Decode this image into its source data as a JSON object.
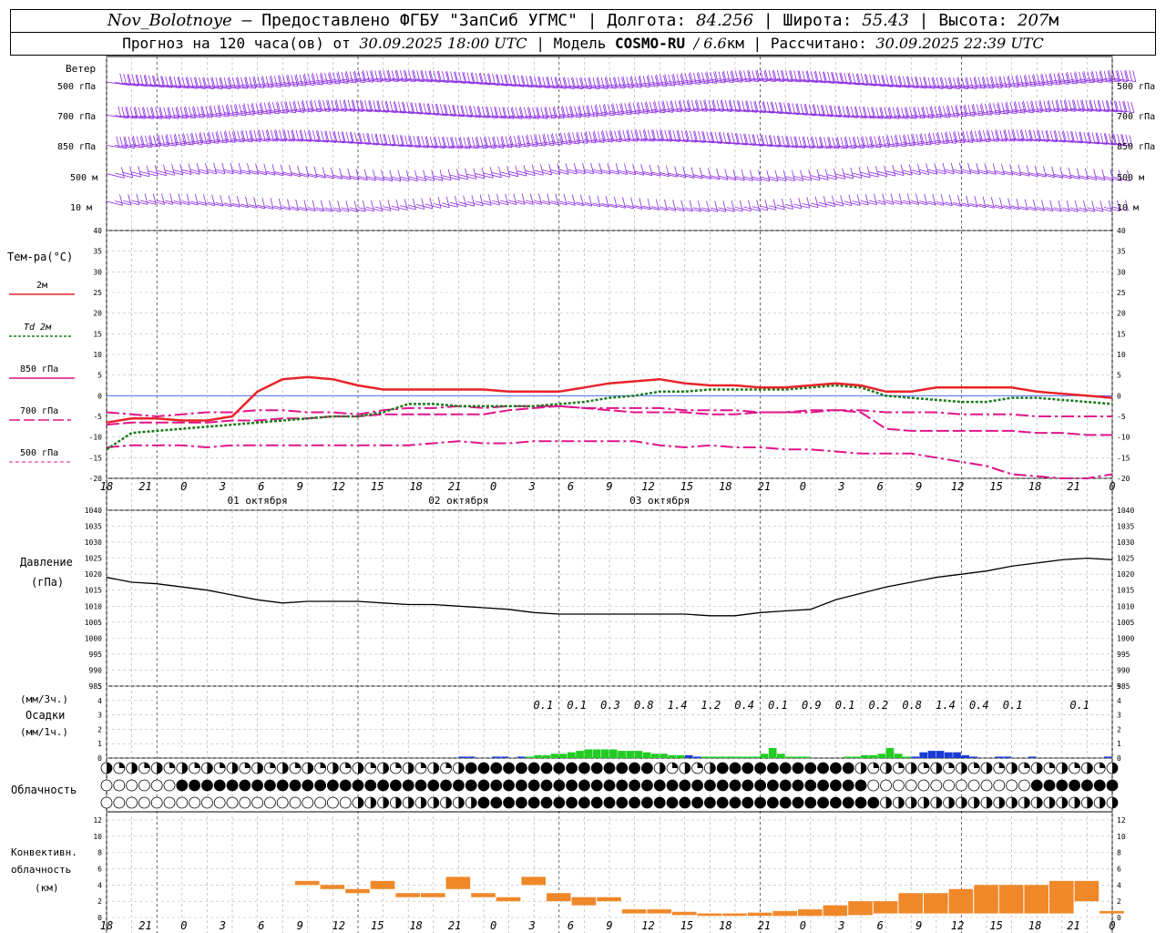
{
  "header": {
    "station": "Nov_Bolotnoye",
    "provider": "– Предоставлено ФГБУ \"ЗапСиб УГМС\" |",
    "lon_label": "Долгота:",
    "lon": "84.256",
    "lat_label": "| Широта:",
    "lat": "55.43",
    "alt_label": "| Высота:",
    "alt": "207",
    "alt_unit": "м",
    "forecast_label": "Прогноз на 120 часа(ов) от",
    "forecast_time": "30.09.2025 18:00 UTC",
    "model_label": "| Модель",
    "model": "COSMO-RU",
    "resolution": "/ 6.6",
    "res_unit": "км",
    "calc_label": "| Рассчитано:",
    "calc_time": "30.09.2025 22:39 UTC"
  },
  "wind": {
    "title": "Ветер",
    "levels": [
      "500 гПа",
      "700 гПа",
      "850 гПа",
      "500 м",
      "10 м"
    ],
    "color": "#8a2be2"
  },
  "temperature": {
    "title": "Тем-ра(°C)",
    "legend": [
      {
        "label": "2м",
        "color": "#e8232a"
      },
      {
        "label": "Td 2м",
        "color": "#1a7a1a"
      },
      {
        "label": "850 гПа",
        "color": "#e0148c"
      },
      {
        "label": "700 гПа",
        "color": "#e0148c"
      },
      {
        "label": "500 гПа",
        "color": "#e0148c"
      }
    ]
  },
  "time_axis": {
    "hour_labels": [
      "18",
      "21",
      "0",
      "3",
      "6",
      "9",
      "12",
      "15",
      "18",
      "21",
      "0",
      "3",
      "6",
      "9",
      "12",
      "15",
      "18",
      "21",
      "0",
      "3",
      "6",
      "9",
      "12",
      "15",
      "18",
      "21",
      "0"
    ],
    "day_labels": [
      "01 октября",
      "02 октября",
      "03 октября"
    ]
  },
  "pressure": {
    "title": "Давление",
    "unit": "(гПа)"
  },
  "precipitation": {
    "unit3": "(мм/3ч.)",
    "title": "Осадки",
    "unit1": "(мм/1ч.)",
    "totals_3h": [
      "",
      "",
      "",
      "",
      "",
      "",
      "",
      "",
      "",
      "",
      "",
      "",
      "",
      "0.1",
      "0.1",
      "0.3",
      "0.8",
      "1.4",
      "1.2",
      "0.4",
      "0.1",
      "0.9",
      "0.1",
      "0.2",
      "0.8",
      "1.4",
      "0.4",
      "0.1",
      "",
      "0.1"
    ],
    "colors": {
      "rain": "#22cc22",
      "heavy": "#1a3ad6"
    }
  },
  "cloudiness": {
    "title": "Облачность"
  },
  "convective": {
    "title_1": "Конвективн.",
    "title_2": "облачность",
    "unit": "(км)",
    "color": "#f0882a"
  },
  "chart_data": [
    {
      "type": "line",
      "title": "Тем-ра(°C)",
      "x_hours_from_start": [
        0,
        3,
        6,
        9,
        12,
        15,
        18,
        21,
        24,
        27,
        30,
        33,
        36,
        39,
        42,
        45,
        48,
        51,
        54,
        57,
        60,
        63,
        66,
        69,
        72,
        75,
        78,
        81,
        84,
        87,
        90,
        93,
        96,
        99,
        102,
        105,
        108,
        111,
        114,
        117,
        120
      ],
      "ylim": [
        -20,
        40
      ],
      "series": [
        {
          "name": "2м",
          "values": [
            -6.5,
            -5.5,
            -5.5,
            -6,
            -6,
            -5,
            1,
            4,
            4.5,
            4,
            2.5,
            1.5,
            1.5,
            1.5,
            1.5,
            1.5,
            1,
            1,
            1,
            2,
            3,
            3.5,
            4,
            3,
            2.5,
            2.5,
            2,
            2,
            2.5,
            3,
            2.5,
            1,
            1,
            2,
            2,
            2,
            2,
            1,
            0.5,
            0,
            -0.5
          ]
        },
        {
          "name": "Td 2м",
          "values": [
            -13,
            -9,
            -8.5,
            -8,
            -7.5,
            -7,
            -6.5,
            -6,
            -5.5,
            -5,
            -5,
            -4,
            -2,
            -2,
            -2.5,
            -2.5,
            -2.5,
            -2.5,
            -2,
            -1.5,
            -0.5,
            0,
            1,
            1,
            1.5,
            1.5,
            1.5,
            1.5,
            2,
            2.5,
            2,
            0,
            -0.5,
            -1,
            -1.5,
            -1.5,
            -0.5,
            -0.5,
            -1,
            -1.5,
            -2
          ]
        },
        {
          "name": "850 гПа",
          "values": [
            -7,
            -6.5,
            -6.5,
            -6.5,
            -6.5,
            -6,
            -6,
            -5.5,
            -5.5,
            -5,
            -5,
            -4.5,
            -4.5,
            -4.5,
            -4.5,
            -4.5,
            -3.5,
            -3,
            -2.5,
            -3,
            -3.5,
            -4,
            -4,
            -4,
            -4.5,
            -4.5,
            -4,
            -4,
            -3.5,
            -3.5,
            -4,
            -8,
            -8.5,
            -8.5,
            -8.5,
            -8.5,
            -8.5,
            -9,
            -9,
            -9.5,
            -9.5
          ]
        },
        {
          "name": "700 гПа",
          "values": [
            -4,
            -4.5,
            -5,
            -4.5,
            -4,
            -4,
            -3.5,
            -3.5,
            -4,
            -4,
            -4.5,
            -3.5,
            -3,
            -3,
            -2.5,
            -3,
            -2.5,
            -2.5,
            -2.5,
            -3,
            -3,
            -3,
            -3,
            -3.5,
            -3.5,
            -3.5,
            -4,
            -4,
            -4,
            -3.5,
            -3.5,
            -4,
            -4,
            -4,
            -4.5,
            -4.5,
            -4.5,
            -5,
            -5,
            -5,
            -5
          ]
        },
        {
          "name": "500 гПа",
          "values": [
            -12.5,
            -12,
            -12,
            -12,
            -12.5,
            -12,
            -12,
            -12,
            -12,
            -12,
            -12,
            -12,
            -12,
            -11.5,
            -11,
            -11.5,
            -11.5,
            -11,
            -11,
            -11,
            -11,
            -11,
            -12,
            -12.5,
            -12,
            -12.5,
            -12.5,
            -13,
            -13,
            -13.5,
            -14,
            -14,
            -14,
            -15,
            -16,
            -17,
            -19,
            -19.5,
            -20,
            -21,
            -19
          ]
        }
      ]
    },
    {
      "type": "line",
      "title": "Давление",
      "x_hours_from_start": [
        0,
        3,
        6,
        9,
        12,
        15,
        18,
        21,
        24,
        27,
        30,
        33,
        36,
        39,
        42,
        45,
        48,
        51,
        54,
        57,
        60,
        63,
        66,
        69,
        72,
        75,
        78,
        81,
        84,
        87,
        90,
        93,
        96,
        99,
        102,
        105,
        108,
        111,
        114,
        117,
        120
      ],
      "ylim": [
        985,
        1040
      ],
      "series": [
        {
          "name": "Давление",
          "values": [
            1019,
            1017.5,
            1017,
            1016,
            1015,
            1013.5,
            1012,
            1011,
            1011.5,
            1011.5,
            1011.5,
            1011,
            1010.5,
            1010.5,
            1010,
            1009.5,
            1009,
            1008,
            1007.5,
            1007.5,
            1007.5,
            1007.5,
            1007.5,
            1007.5,
            1007,
            1007,
            1008,
            1008.5,
            1009,
            1012,
            1014,
            1016,
            1017.5,
            1019,
            1020,
            1021,
            1022.5,
            1023.5,
            1024.5,
            1025,
            1024.5
          ]
        }
      ]
    },
    {
      "type": "bar",
      "title": "Осадки",
      "x_hours_from_start": [
        43,
        44,
        45,
        46,
        47,
        48,
        49,
        50,
        51,
        52,
        53,
        54,
        55,
        56,
        57,
        58,
        59,
        60,
        61,
        62,
        63,
        64,
        65,
        66,
        67,
        68,
        69,
        70,
        71,
        72,
        73,
        74,
        75,
        76,
        77,
        78,
        79,
        80,
        81,
        82,
        83,
        84,
        85,
        86,
        87,
        88,
        89,
        90,
        91,
        92,
        93,
        94,
        95,
        96,
        97,
        98,
        99,
        100,
        101,
        102,
        103,
        104,
        105,
        106,
        107,
        108,
        109,
        110,
        111,
        112,
        113,
        114,
        115,
        116,
        117,
        118,
        119,
        120
      ],
      "ylim": [
        0,
        5
      ],
      "series": [
        {
          "name": "мм/1ч",
          "values": [
            0.1,
            0.1,
            0,
            0,
            0.1,
            0.1,
            0,
            0.1,
            0.1,
            0.2,
            0.2,
            0.3,
            0.3,
            0.4,
            0.5,
            0.6,
            0.6,
            0.6,
            0.6,
            0.5,
            0.5,
            0.5,
            0.4,
            0.3,
            0.3,
            0.2,
            0.2,
            0.2,
            0.1,
            0.1,
            0.1,
            0.1,
            0.1,
            0.1,
            0.1,
            0.1,
            0.3,
            0.7,
            0.3,
            0.1,
            0.1,
            0.1,
            0,
            0,
            0,
            0,
            0.1,
            0.1,
            0.2,
            0.2,
            0.3,
            0.7,
            0.3,
            0.1,
            0.1,
            0.4,
            0.5,
            0.5,
            0.4,
            0.4,
            0.2,
            0.1,
            0,
            0,
            0.1,
            0.1,
            0,
            0,
            0.1,
            0,
            0,
            0,
            0,
            0,
            0,
            0,
            0,
            0.1
          ]
        }
      ]
    },
    {
      "type": "bar",
      "title": "Конвективн. облачность",
      "x_hours_from_start": [
        0,
        3,
        6,
        9,
        12,
        15,
        18,
        21,
        24,
        27,
        30,
        33,
        36,
        39,
        42,
        45,
        48,
        51,
        54,
        57,
        60,
        63,
        66,
        69,
        72,
        75,
        78,
        81,
        84,
        87,
        90,
        93,
        96,
        99,
        102,
        105,
        108,
        111,
        114,
        117,
        120
      ],
      "ylim": [
        0,
        13
      ],
      "series": [
        {
          "name": "нижняя граница (км)",
          "values": [
            0,
            0,
            0,
            0,
            0,
            0,
            0,
            0,
            4,
            3.5,
            3,
            3.5,
            2.5,
            2.5,
            3.5,
            2.5,
            2,
            4,
            2,
            1.5,
            2,
            0.5,
            0.5,
            0.3,
            0.2,
            0.2,
            0.2,
            0.2,
            0.2,
            0.2,
            0.3,
            0.5,
            0.5,
            0.5,
            0.5,
            0.5,
            0.5,
            0.5,
            0.5,
            2,
            0.5
          ]
        },
        {
          "name": "верхняя граница (км)",
          "values": [
            0,
            0,
            0,
            0,
            0,
            0,
            0,
            0,
            4.5,
            4,
            3.5,
            4.5,
            3,
            3,
            5,
            3,
            2.5,
            5,
            3,
            2.5,
            2.5,
            1,
            1,
            0.7,
            0.5,
            0.5,
            0.6,
            0.8,
            1,
            1.5,
            2,
            2,
            3,
            3,
            3.5,
            4,
            4,
            4,
            4.5,
            4.5,
            0.8
          ]
        }
      ]
    }
  ]
}
